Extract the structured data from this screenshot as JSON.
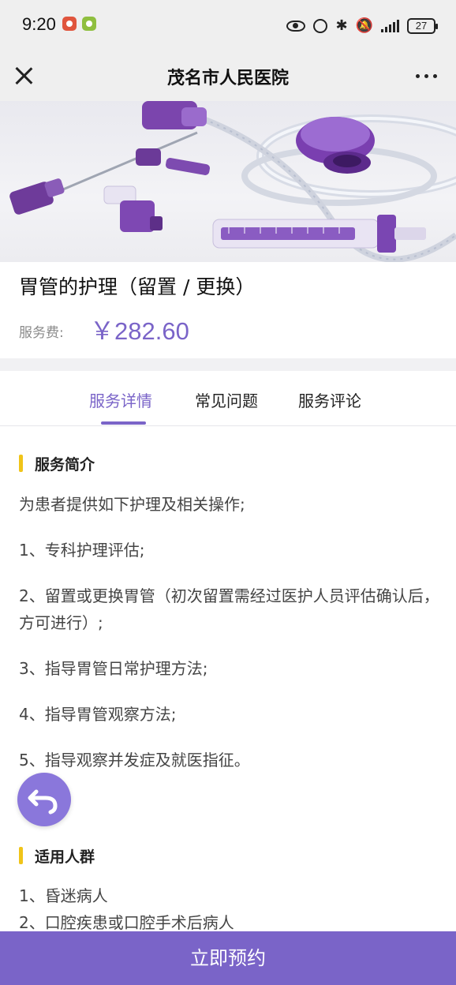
{
  "status_bar": {
    "time": "9:20",
    "battery": "27"
  },
  "nav": {
    "title": "茂名市人民医院"
  },
  "product": {
    "title": "胃管的护理（留置 / 更换）",
    "price_label": "服务费:",
    "price": "￥282.60"
  },
  "tabs": [
    {
      "label": "服务详情"
    },
    {
      "label": "常见问题"
    },
    {
      "label": "服务评论"
    }
  ],
  "sections": [
    {
      "heading": "服务简介",
      "paragraphs": [
        "为患者提供如下护理及相关操作;",
        "1、专科护理评估;",
        "2、留置或更换胃管（初次留置需经过医护人员评估确认后，方可进行）;",
        "3、指导胃管日常护理方法;",
        "4、指导胃管观察方法;",
        "5、指导观察并发症及就医指征。"
      ]
    },
    {
      "heading": "适用人群",
      "paragraphs": [
        "1、昏迷病人",
        "2、口腔疾患或口腔手术后病人"
      ]
    }
  ],
  "bottom": {
    "book_label": "立即预约"
  },
  "colors": {
    "accent": "#7a64c8",
    "section_marker": "#f0c419",
    "fab": "#8a77db"
  },
  "icons": {
    "close": "close-icon",
    "more": "more-icon",
    "back": "undo-arrow-icon"
  }
}
